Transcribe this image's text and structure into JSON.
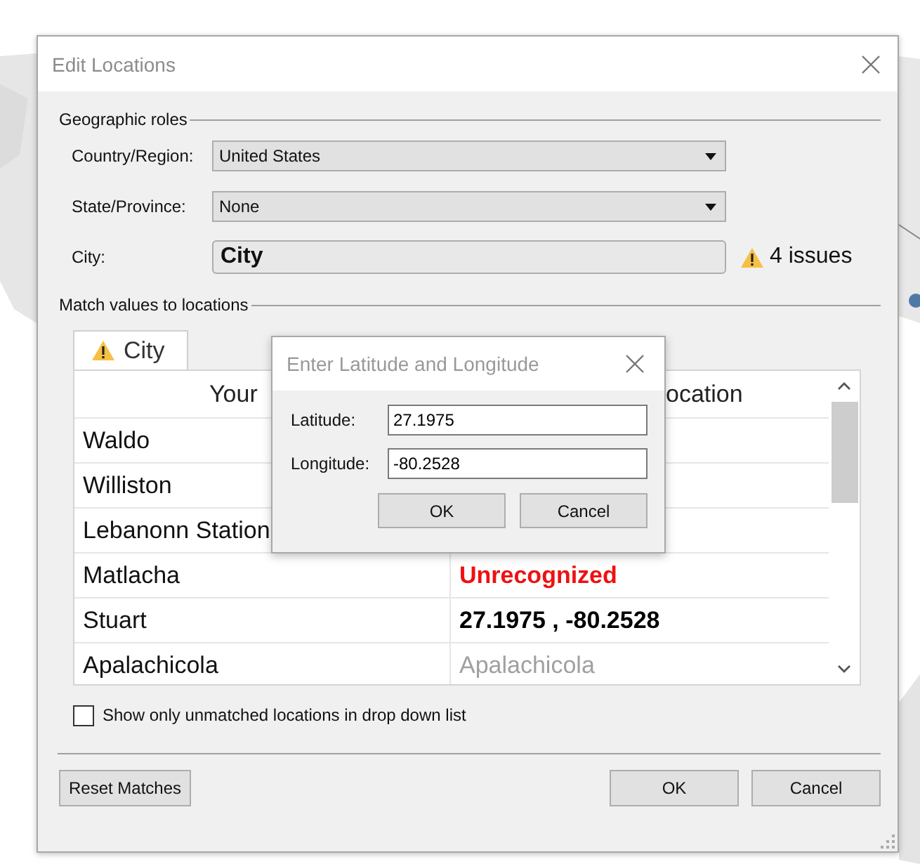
{
  "window": {
    "title": "Edit Locations"
  },
  "geographic_roles": {
    "heading": "Geographic roles",
    "fields": [
      {
        "label": "Country/Region:",
        "kind": "dropdown",
        "value": "United States"
      },
      {
        "label": "State/Province:",
        "kind": "dropdown",
        "value": "None"
      },
      {
        "label": "City:",
        "kind": "field",
        "value": "City",
        "issues": "4 issues"
      }
    ]
  },
  "match": {
    "heading": "Match values to locations",
    "tabs": [
      {
        "label": "City",
        "selected": true
      }
    ],
    "columns": [
      "Your",
      "ocation"
    ],
    "rows": [
      {
        "value": "Waldo"
      },
      {
        "value": "Williston"
      },
      {
        "value": "Lebanonn Station"
      },
      {
        "value": "Matlacha",
        "match": "Unrecognized",
        "kind": "unrecognized"
      },
      {
        "value": "Stuart",
        "match": "27.1975 , -80.2528",
        "kind": "coordinates"
      },
      {
        "value": "Apalachicola",
        "match": "Apalachicola",
        "kind": "suggested"
      }
    ]
  },
  "checkbox": {
    "label": "Show only unmatched locations in drop down list",
    "checked": false
  },
  "buttons": [
    {
      "label": "Reset Matches",
      "kind": "left"
    },
    {
      "label": "OK",
      "kind": "right"
    },
    {
      "label": "Cancel",
      "kind": "right"
    }
  ],
  "latlng_dialog": {
    "title": "Enter Latitude and Longitude",
    "fields": [
      {
        "label": "Latitude:",
        "value": "27.1975"
      },
      {
        "label": "Longitude:",
        "value": "-80.2528"
      }
    ],
    "buttons": [
      "OK",
      "Cancel"
    ]
  }
}
